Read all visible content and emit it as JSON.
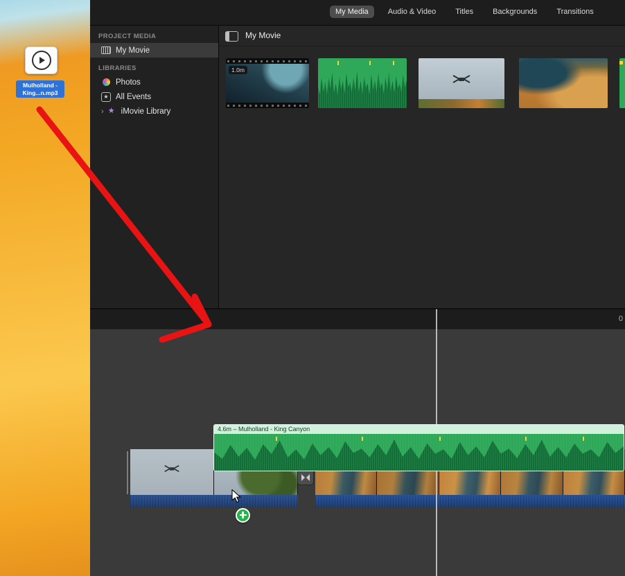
{
  "desktop": {
    "file_label_line1": "Mulholland -",
    "file_label_line2": "King...n.mp3"
  },
  "topbar": {
    "tabs": [
      {
        "label": "My Media",
        "active": true
      },
      {
        "label": "Audio & Video",
        "active": false
      },
      {
        "label": "Titles",
        "active": false
      },
      {
        "label": "Backgrounds",
        "active": false
      },
      {
        "label": "Transitions",
        "active": false
      }
    ]
  },
  "sidebar": {
    "project_media_header": "PROJECT MEDIA",
    "project_items": [
      {
        "label": "My Movie",
        "selected": true
      }
    ],
    "libraries_header": "LIBRARIES",
    "library_items": [
      {
        "label": "Photos"
      },
      {
        "label": "All Events"
      },
      {
        "label": "iMovie Library"
      }
    ]
  },
  "browser": {
    "title": "My Movie",
    "clips": [
      {
        "type": "video",
        "duration_badge": "1.0m"
      },
      {
        "type": "audio"
      },
      {
        "type": "photo-drone"
      },
      {
        "type": "photo-aerial"
      },
      {
        "type": "audio-partial"
      }
    ]
  },
  "timeline": {
    "ruler_label": "0",
    "dragged_audio_clip": {
      "label": "4.6m – Mulholland - King Canyon"
    }
  },
  "colors": {
    "audio_green": "#2fa85a",
    "waveform_dark_green": "#0f6f35",
    "audio_track_blue": "#24477e",
    "annotation_red": "#e81313",
    "selection_blue": "#2e72d8"
  }
}
